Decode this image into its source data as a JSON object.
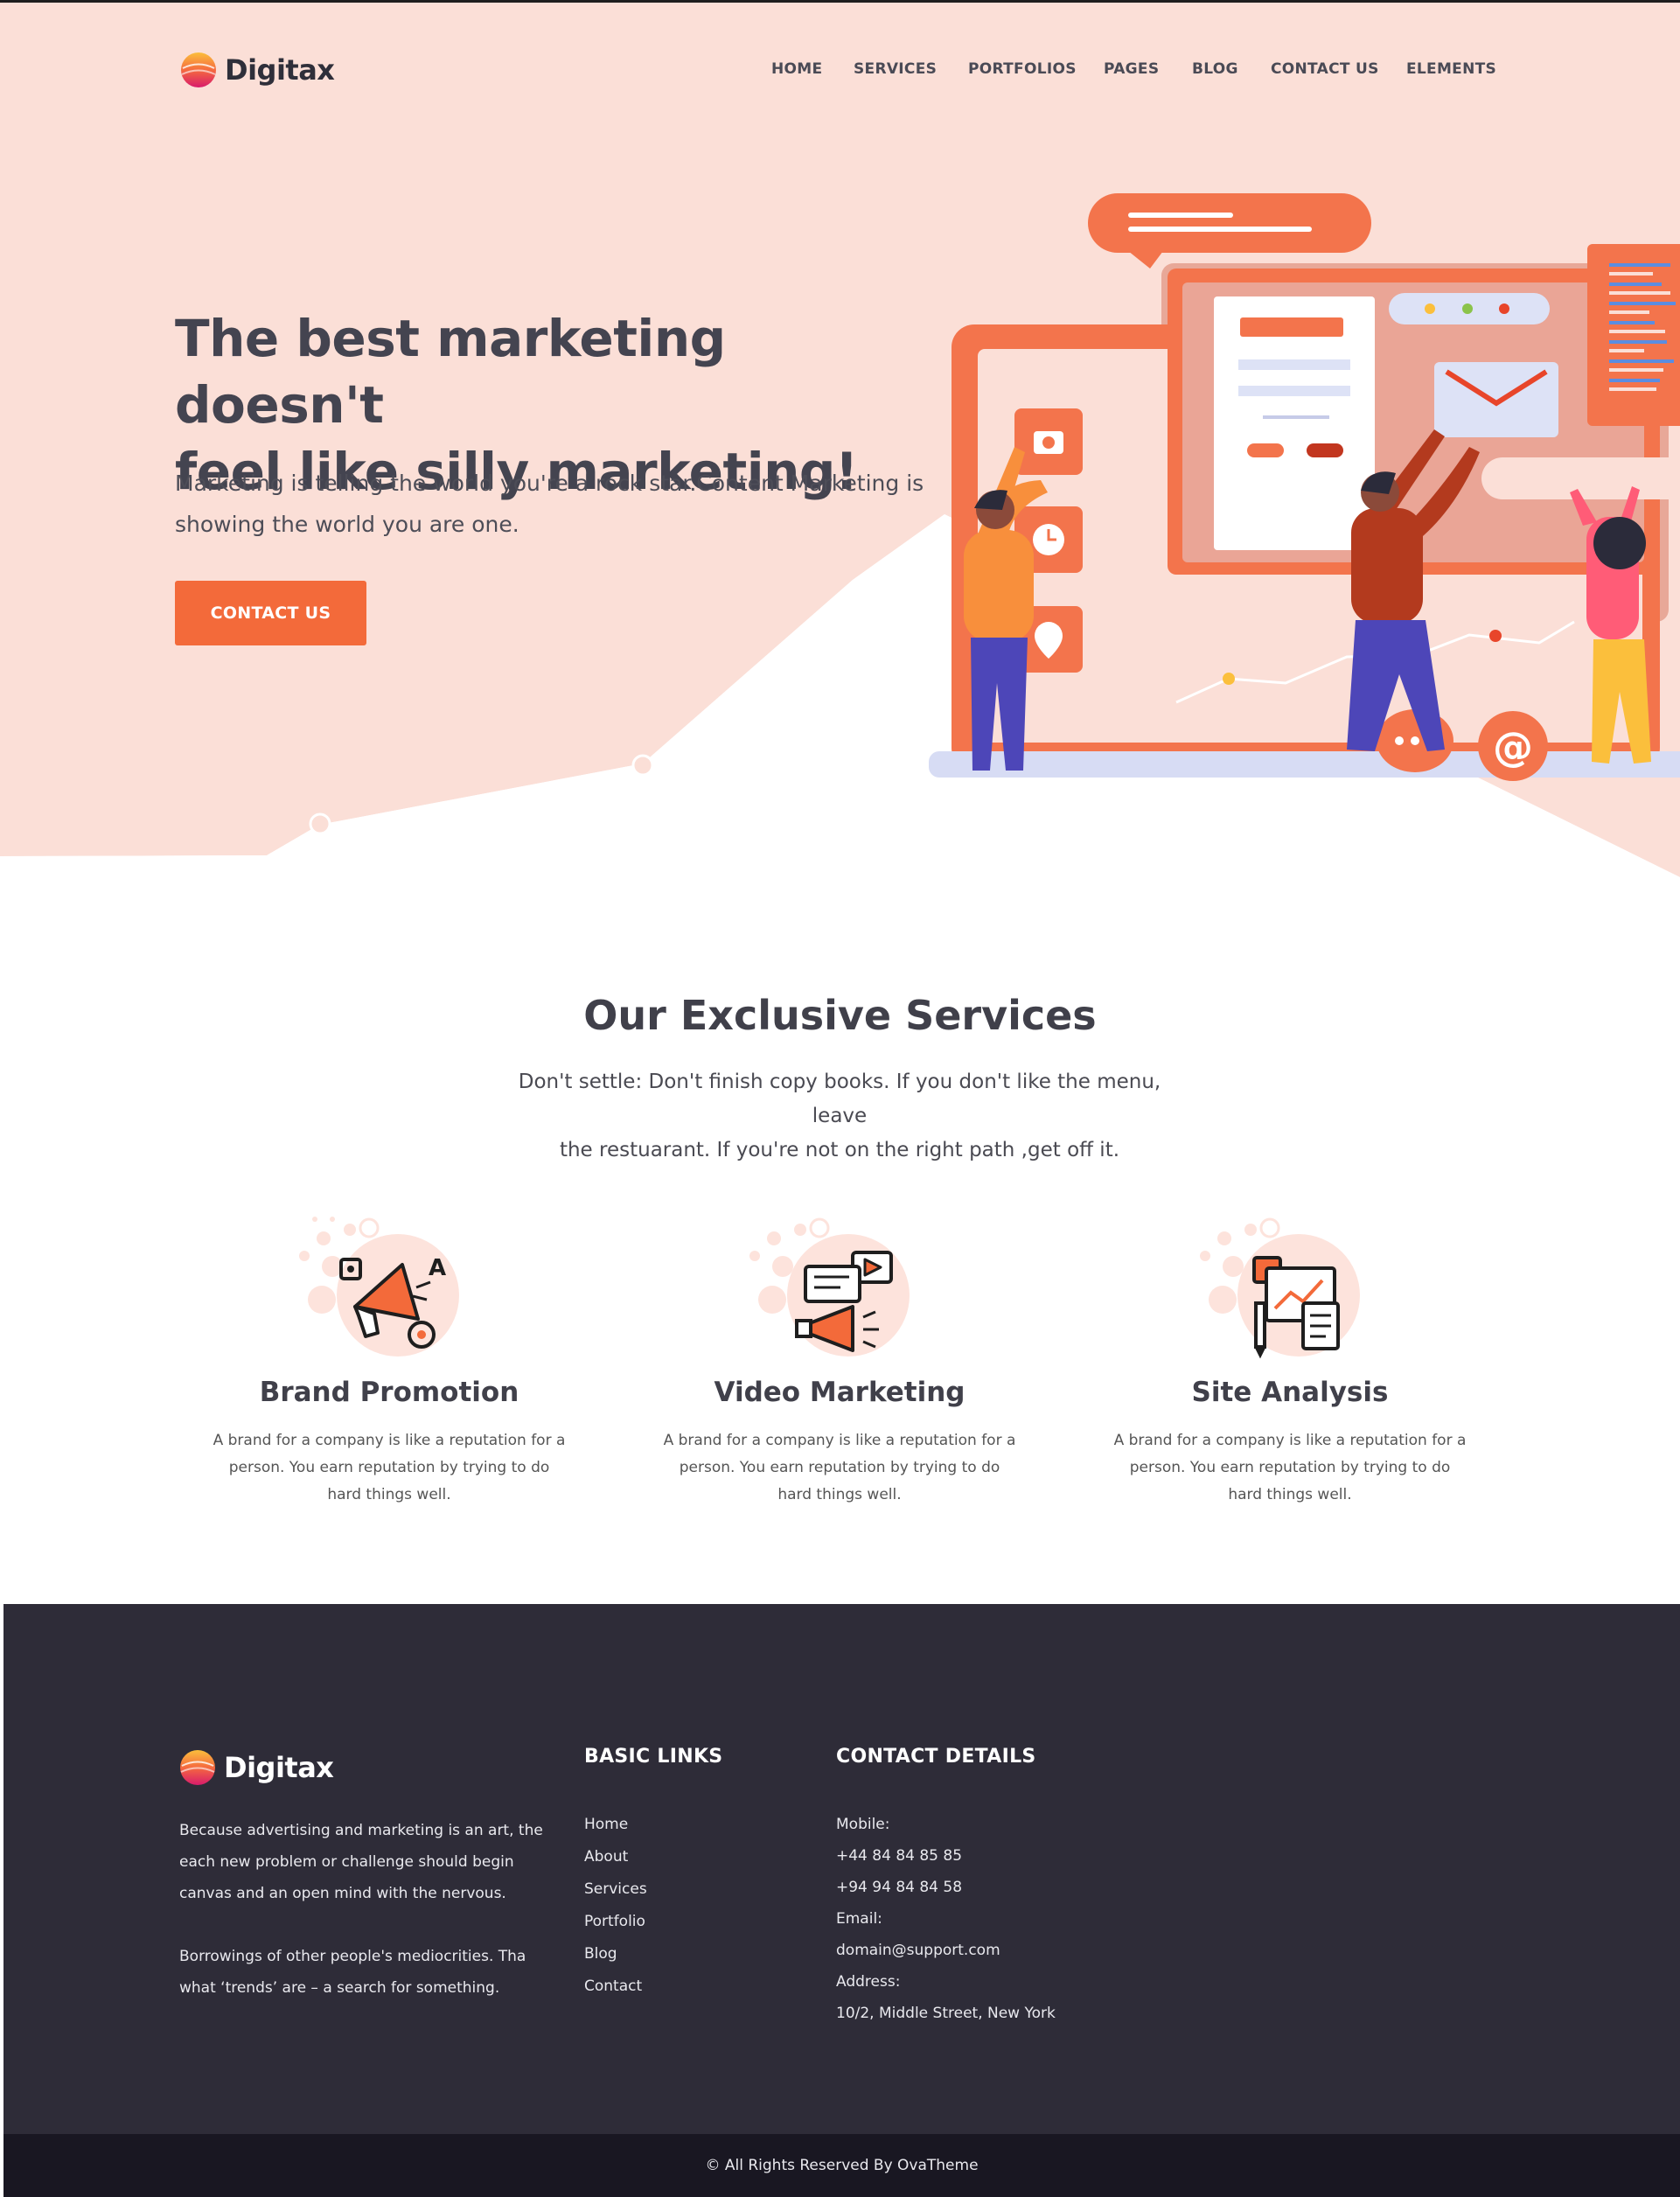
{
  "brand": {
    "name": "Digitax"
  },
  "nav": {
    "items": [
      "HOME",
      "SERVICES",
      "PORTFOLIOS",
      "PAGES",
      "BLOG",
      "CONTACT US",
      "ELEMENTS"
    ]
  },
  "hero": {
    "title_line1": "The best marketing doesn't",
    "title_line2": "feel like silly marketing!",
    "subtitle_line1": "Marketing is telling the world you're a rock star.Content Marketing is",
    "subtitle_line2": "showing the world you are one.",
    "cta": "CONTACT US"
  },
  "services": {
    "title": "Our Exclusive Services",
    "subtitle_line1": "Don't settle: Don't finish copy books. If you don't like the menu, leave",
    "subtitle_line2": "the restuarant. If you're not on the right path ,get off it.",
    "cards": [
      {
        "title": "Brand Promotion",
        "icon": "megaphone-icon",
        "line1": "A brand for a company is like a reputation for a",
        "line2": "person. You earn reputation by trying to do",
        "line3": "hard things well."
      },
      {
        "title": "Video Marketing",
        "icon": "video-marketing-icon",
        "line1": "A brand for a company is like a reputation for a",
        "line2": "person. You earn reputation by trying to do",
        "line3": "hard things well."
      },
      {
        "title": "Site Analysis",
        "icon": "site-analysis-icon",
        "line1": "A brand for a company is like a reputation for a",
        "line2": "person. You earn reputation by trying to do",
        "line3": "hard things well."
      }
    ]
  },
  "footer": {
    "about": {
      "p1_line1": "Because advertising and marketing is an art, the",
      "p1_line2": "each new problem or challenge should begin",
      "p1_line3": "canvas and an open mind with the nervous.",
      "p2_line1": "Borrowings of other people's mediocrities. Tha",
      "p2_line2": "what ‘trends’ are – a search for something."
    },
    "links_title": "BASIC LINKS",
    "links": [
      "Home",
      "About",
      "Services",
      "Portfolio",
      "Blog",
      "Contact"
    ],
    "contact_title": "CONTACT DETAILS",
    "contact": {
      "mobile_label": "Mobile:",
      "phone1": "+44 84 84 85 85",
      "phone2": "+94 94 84 84 58",
      "email_label": "Email:",
      "email": "domain@support.com",
      "address_label": "Address:",
      "address": "10/2, Middle Street, New York"
    },
    "copyright": "© All Rights Reserved By OvaTheme"
  },
  "colors": {
    "hero_bg": "#fbdfd7",
    "accent": "#f36a3a",
    "footer_bg": "#2e2c38",
    "copyright_bg": "#191722"
  }
}
